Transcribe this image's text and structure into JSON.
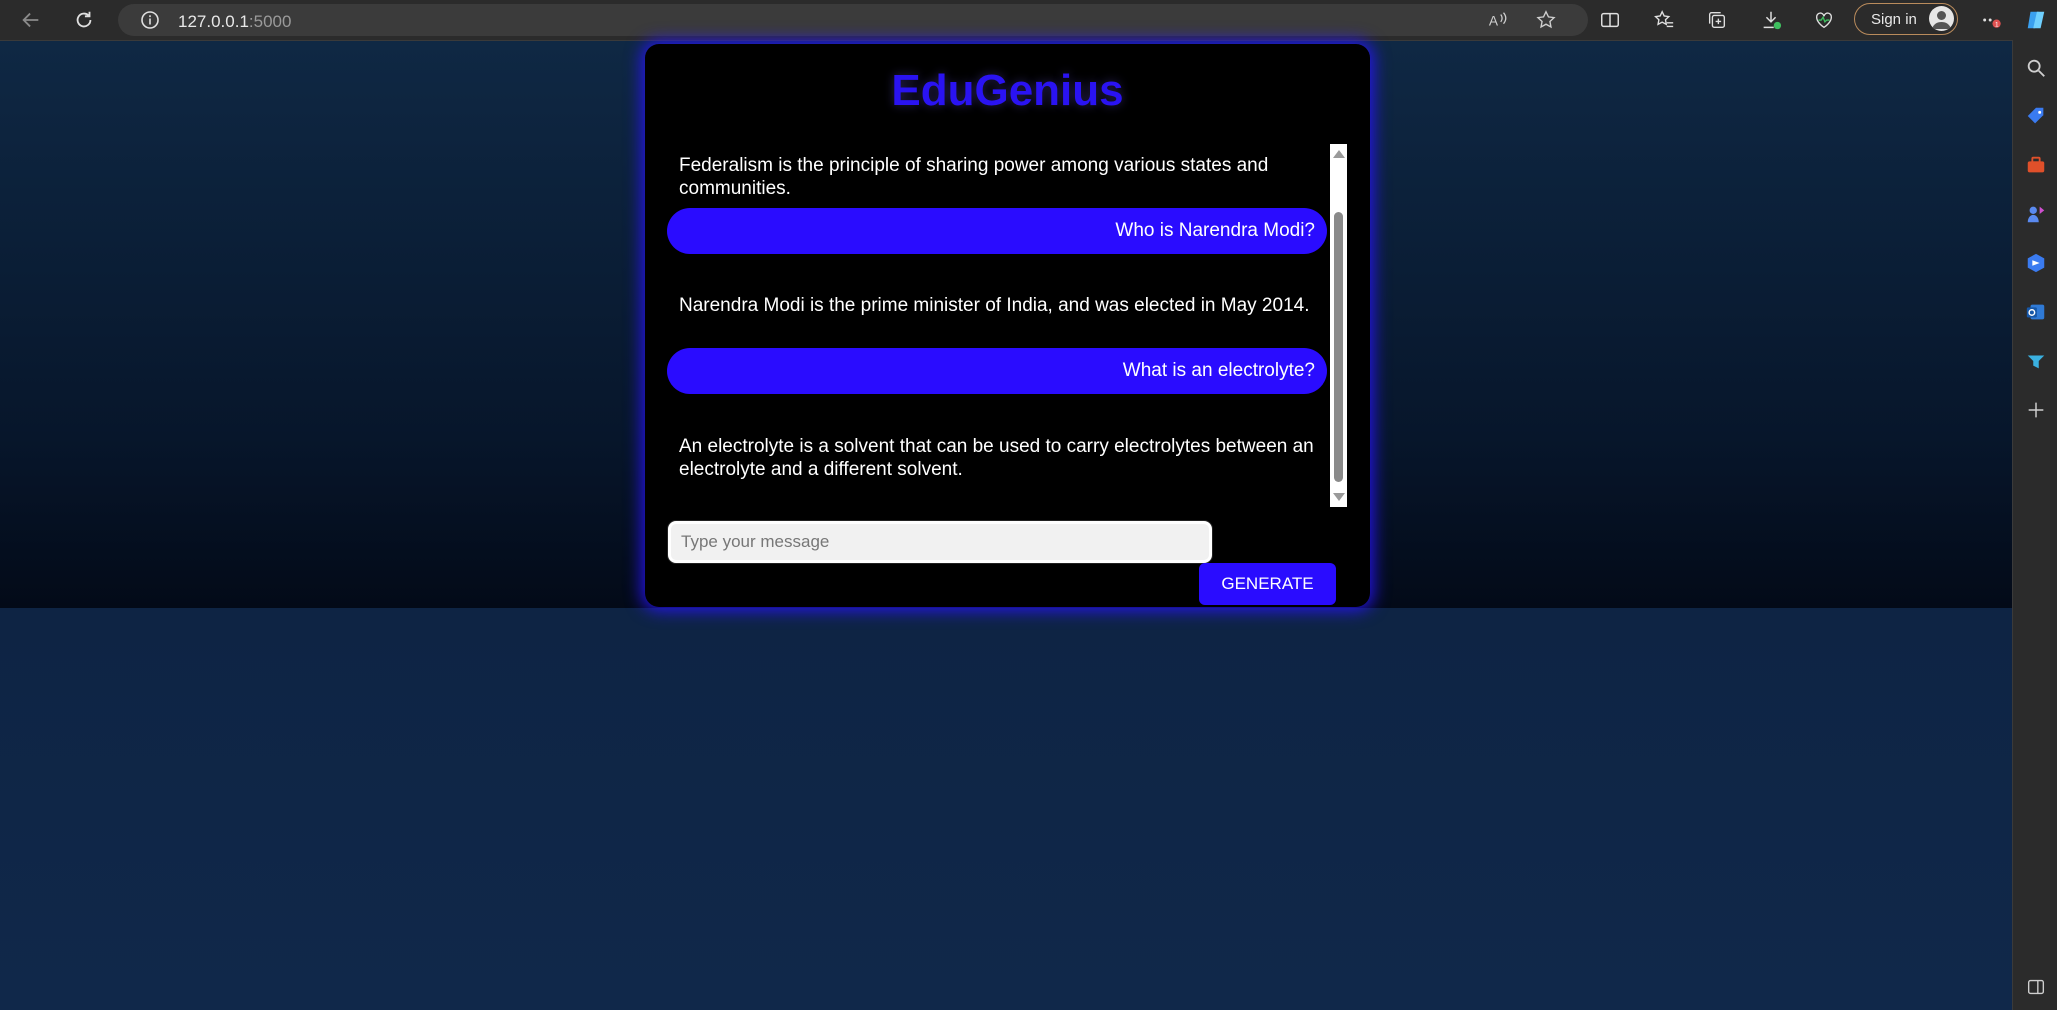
{
  "browser": {
    "url_host": "127.0.0.1",
    "url_port": ":5000",
    "sign_in_label": "Sign in"
  },
  "app": {
    "title": "EduGenius",
    "messages": [
      {
        "role": "bot",
        "text": "Federalism is the principle of sharing power among various states and communities."
      },
      {
        "role": "user",
        "text": "Who is Narendra Modi?"
      },
      {
        "role": "bot",
        "text": "Narendra Modi is the prime minister of India, and was elected in May 2014."
      },
      {
        "role": "user",
        "text": "What is an electrolyte?"
      },
      {
        "role": "bot",
        "text": "An electrolyte is a solvent that can be used to carry electrolytes between an electrolyte and a different solvent."
      }
    ],
    "input_placeholder": "Type your message",
    "generate_label": "GENERATE"
  },
  "colors": {
    "accent": "#2a0cff",
    "title": "#2a13f2",
    "card": "#000000"
  },
  "icons": {
    "toolbar": [
      "back-arrow-icon",
      "refresh-icon",
      "info-icon",
      "read-aloud-icon",
      "favorite-star-icon",
      "split-screen-icon",
      "favorites-icon",
      "collections-icon",
      "downloads-icon",
      "browser-essentials-icon",
      "more-icon"
    ],
    "sidebar": [
      "search-icon",
      "shopping-icon",
      "tools-icon",
      "games-icon",
      "copilot-icon",
      "outlook-icon",
      "drop-icon",
      "add-icon",
      "sidebar-toggle-icon"
    ]
  }
}
